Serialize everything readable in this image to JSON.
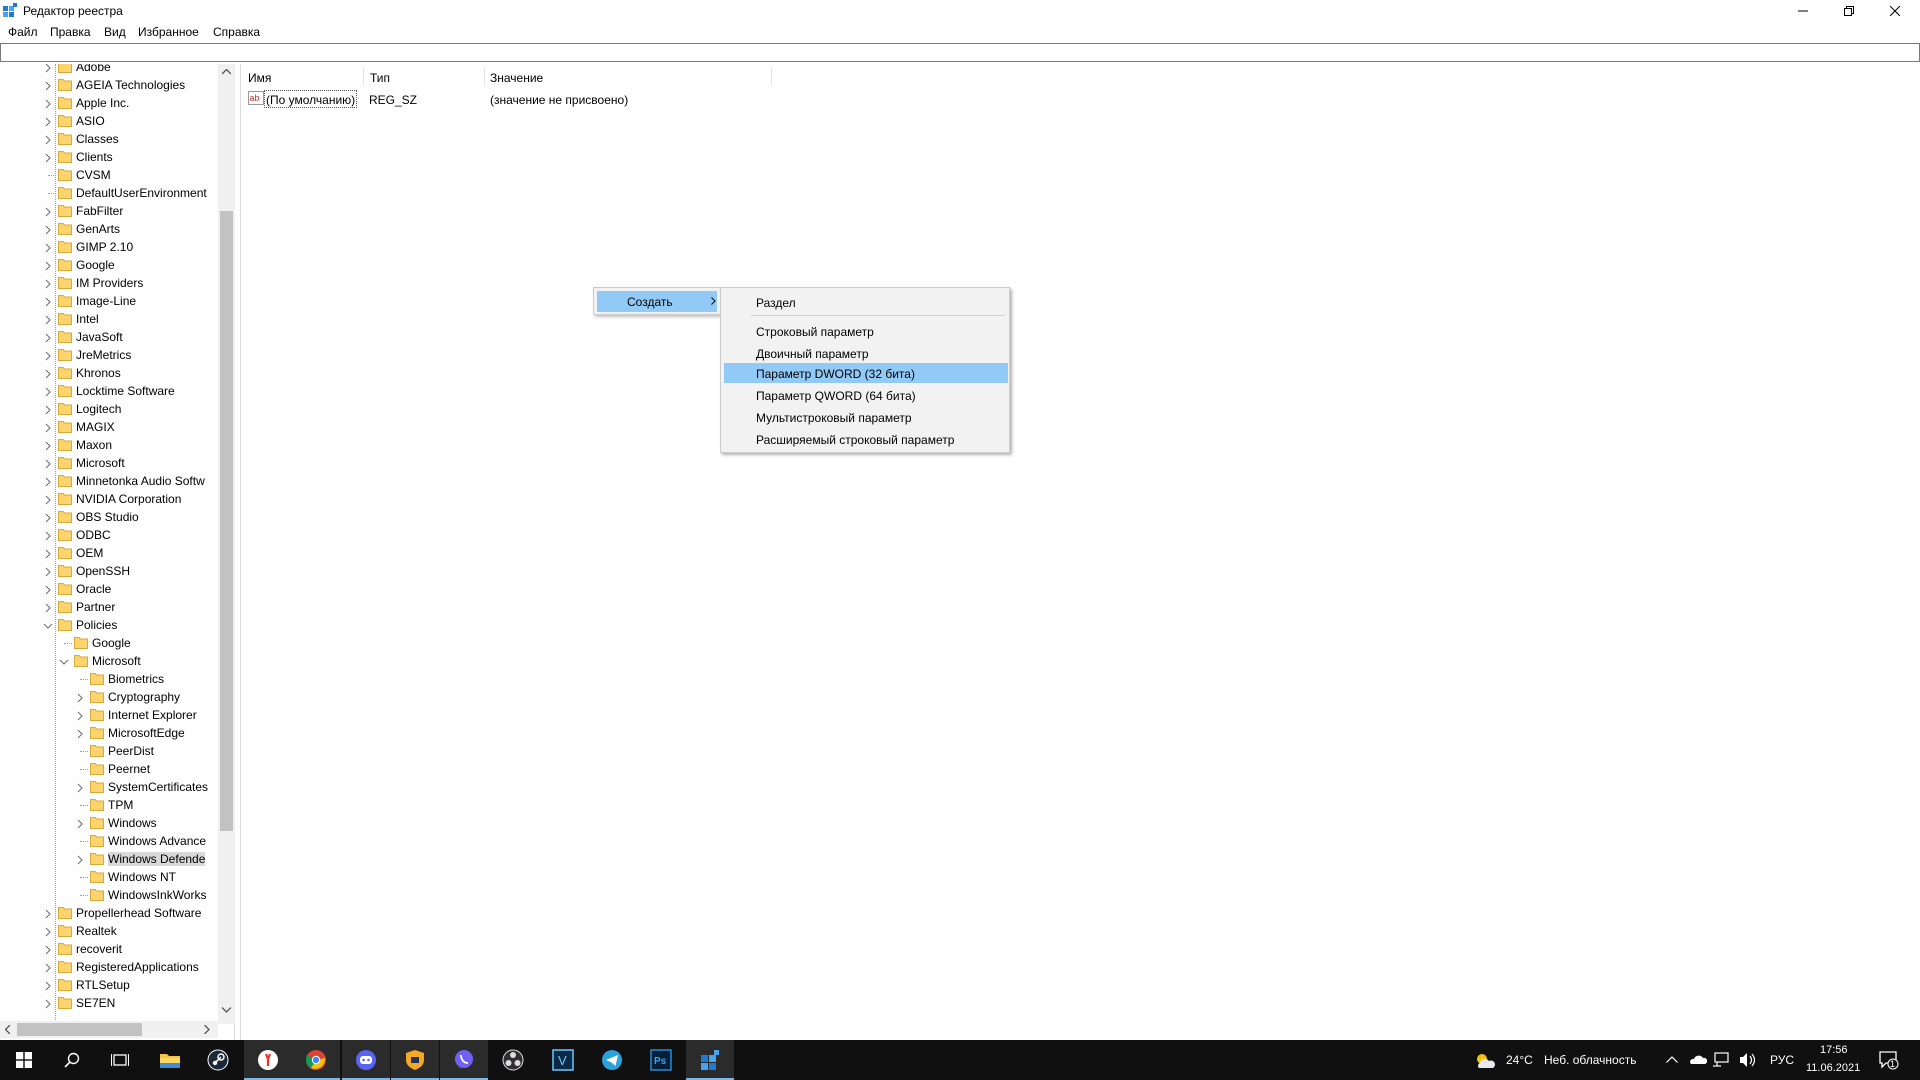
{
  "window": {
    "title": "Редактор реестра",
    "controls": [
      "minimize",
      "restore",
      "close"
    ]
  },
  "menu": [
    "Файл",
    "Правка",
    "Вид",
    "Избранное",
    "Справка"
  ],
  "address": "",
  "tree": {
    "top_level": [
      "Adobe",
      "AGEIA Technologies",
      "Apple Inc.",
      "ASIO",
      "Classes",
      "Clients",
      "CVSM",
      "DefaultUserEnvironment",
      "FabFilter",
      "GenArts",
      "GIMP 2.10",
      "Google",
      "IM Providers",
      "Image-Line",
      "Intel",
      "JavaSoft",
      "JreMetrics",
      "Khronos",
      "Locktime Software",
      "Logitech",
      "MAGIX",
      "Maxon",
      "Microsoft",
      "Minnetonka Audio Softw",
      "NVIDIA Corporation",
      "OBS Studio",
      "ODBC",
      "OEM",
      "OpenSSH",
      "Oracle",
      "Partner",
      "Policies"
    ],
    "policies_children": [
      "Google",
      "Microsoft"
    ],
    "policies_microsoft_children": [
      "Biometrics",
      "Cryptography",
      "Internet Explorer",
      "MicrosoftEdge",
      "PeerDist",
      "Peernet",
      "SystemCertificates",
      "TPM",
      "Windows",
      "Windows Advance",
      "Windows Defende",
      "Windows NT",
      "WindowsInkWorks"
    ],
    "after_policies": [
      "Propellerhead Software",
      "Realtek",
      "recoverit",
      "RegisteredApplications",
      "RTLSetup",
      "SE7EN"
    ]
  },
  "list": {
    "columns": [
      "Имя",
      "Тип",
      "Значение"
    ],
    "rows": [
      {
        "name": "(По умолчанию)",
        "type": "REG_SZ",
        "data": "(значение не присвоено)"
      }
    ]
  },
  "context_menu": {
    "create_label": "Создать",
    "submenu": {
      "section": "Раздел",
      "items": [
        "Строковый параметр",
        "Двоичный параметр",
        "Параметр DWORD (32 бита)",
        "Параметр QWORD (64 бита)",
        "Мультистроковый параметр",
        "Расширяемый строковый параметр"
      ],
      "highlighted": "Параметр DWORD (32 бита)"
    }
  },
  "taskbar": {
    "weather": {
      "temp": "24°C",
      "desc": "Неб. облачность"
    },
    "language": "РУС",
    "time": "17:56",
    "date": "11.06.2021",
    "notification_count": "1"
  }
}
